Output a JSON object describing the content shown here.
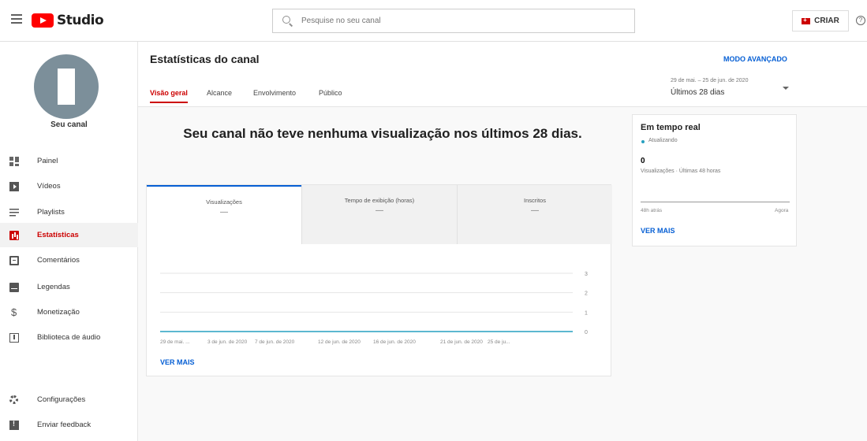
{
  "header": {
    "logo_text": "Studio",
    "search_placeholder": "Pesquise no seu canal",
    "create_label": "CRIAR",
    "help_glyph": "?"
  },
  "sidebar": {
    "channel_name": "Seu canal",
    "items": [
      {
        "label": "Painel",
        "icon": "dashboard-icon"
      },
      {
        "label": "Vídeos",
        "icon": "video-icon"
      },
      {
        "label": "Playlists",
        "icon": "playlist-icon"
      },
      {
        "label": "Estatísticas",
        "icon": "analytics-icon",
        "active": true
      },
      {
        "label": "Comentários",
        "icon": "comment-icon"
      },
      {
        "label": "Legendas",
        "icon": "subtitles-icon"
      },
      {
        "label": "Monetização",
        "icon": "dollar-icon"
      },
      {
        "label": "Biblioteca de áudio",
        "icon": "audio-library-icon"
      }
    ],
    "bottom_items": [
      {
        "label": "Configurações",
        "icon": "gear-icon"
      },
      {
        "label": "Enviar feedback",
        "icon": "feedback-icon"
      }
    ],
    "money_glyph": "$"
  },
  "page": {
    "title": "Estatísticas do canal",
    "tabs": [
      "Visão geral",
      "Alcance",
      "Envolvimento",
      "Público"
    ],
    "advanced_mode": "MODO AVANÇADO",
    "date_range": "29 de mai. – 25 de jun. de 2020",
    "period": "Últimos 28 dias"
  },
  "overview": {
    "message": "Seu canal não teve nenhuma visualização nos últimos 28 dias.",
    "metrics": [
      {
        "label": "Visualizações",
        "value": "—"
      },
      {
        "label": "Tempo de exibição (horas)",
        "value": "—"
      },
      {
        "label": "Inscritos",
        "value": "—"
      }
    ],
    "see_more": "VER MAIS"
  },
  "chart_data": {
    "type": "line",
    "x": [
      "29 de mai. ...",
      "3 de jun. de 2020",
      "7 de jun. de 2020",
      "12 de jun. de 2020",
      "16 de jun. de 2020",
      "21 de jun. de 2020",
      "25 de ju..."
    ],
    "series": [
      {
        "values": [
          0,
          0,
          0,
          0,
          0,
          0,
          0
        ]
      }
    ],
    "yticks": [
      0,
      1,
      2,
      3
    ],
    "ylim": [
      0,
      3
    ],
    "title": "",
    "xlabel": "",
    "ylabel": "",
    "line_color": "#27a0c0",
    "grid": true
  },
  "realtime": {
    "title": "Em tempo real",
    "status": "Atualizando",
    "count": "0",
    "subtitle": "Visualizações · Últimas 48 horas",
    "axis_left": "48h atrás",
    "axis_right": "Agora",
    "see_more": "VER MAIS"
  }
}
